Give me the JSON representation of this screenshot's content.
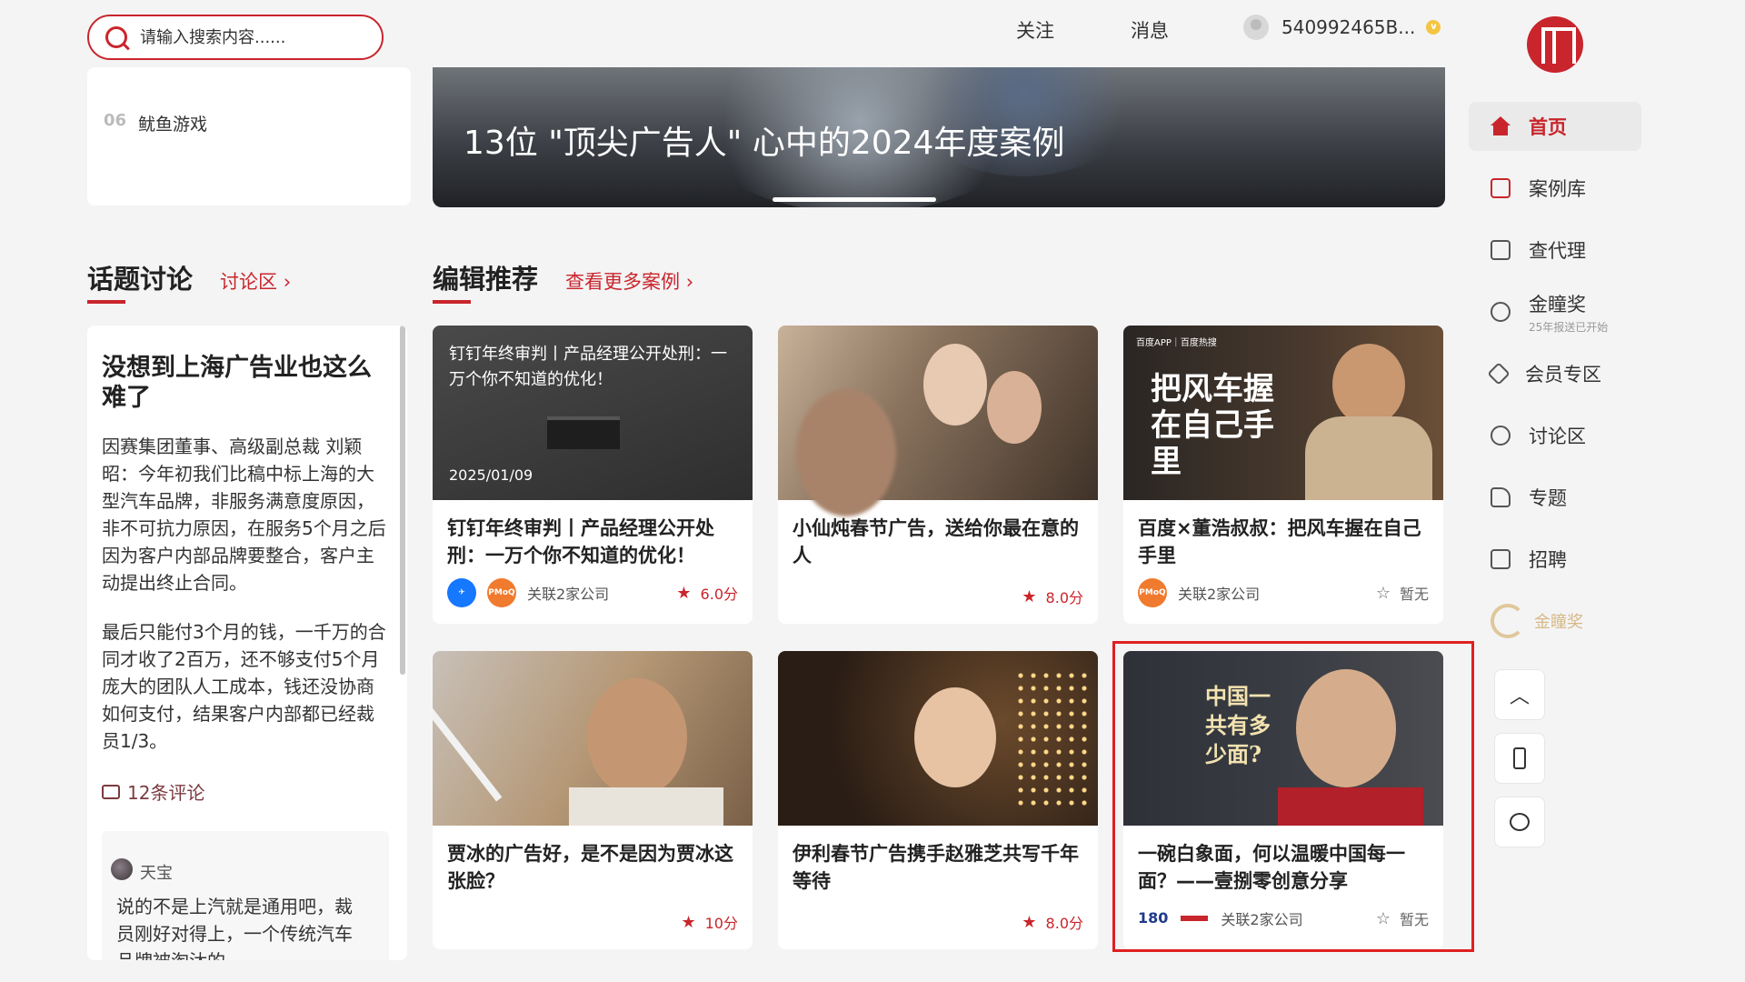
{
  "search": {
    "placeholder": "请输入搜索内容......"
  },
  "topnav": {
    "follow": "关注",
    "messages": "消息",
    "username": "540992465B...",
    "vip_badge": "v"
  },
  "ranking": {
    "number": "06",
    "label": "鱿鱼游戏"
  },
  "banner": {
    "title": "13位 \"顶尖广告人\" 心中的2024年度案例"
  },
  "discussion_section": {
    "title": "话题讨论",
    "link": "讨论区 ›"
  },
  "editor_section": {
    "title": "编辑推荐",
    "link": "查看更多案例 ›"
  },
  "discussion": {
    "title": "没想到上海广告业也这么难了",
    "para1": "因赛集团董事、高级副总裁 刘颖昭：今年初我们比稿中标上海的大型汽车品牌，非服务满意度原因，非不可抗力原因，在服务5个月之后因为客户内部品牌要整合，客户主动提出终止合同。",
    "para2": "最后只能付3个月的钱，一千万的合同才收了2百万，还不够支付5个月庞大的团队人工成本，钱还没协商如何支付，结果客户内部都已经裁员1/3。",
    "comments": "12条评论",
    "reply_user": "天宝",
    "reply_text": "说的不是上汽就是通用吧，裁员刚好对得上，一个传统汽车品牌被淘汰的"
  },
  "cards": [
    {
      "title": "钉钉年终审判丨产品经理公开处刑：一万个你不知道的优化！",
      "overlay": "钉钉年终审判丨产品经理公开处刑：一万个你不知道的优化！",
      "date": "2025/01/09",
      "company": "关联2家公司",
      "score": "6.0分",
      "logo1": "",
      "logo2": "PMoQ"
    },
    {
      "title": "小仙炖春节广告，送给你最在意的人",
      "company": "",
      "score": "8.0分"
    },
    {
      "title": "百度×董浩叔叔：把风车握在自己手里",
      "company": "关联2家公司",
      "score": "暂无",
      "logo2": "PMoQ",
      "img_text": "把风车握在自己手里",
      "img_tag": "百度APP｜百度热搜"
    },
    {
      "title": "贾冰的广告好，是不是因为贾冰这张脸？",
      "company": "",
      "score": "10分"
    },
    {
      "title": "伊利春节广告携手赵雅芝共写千年等待",
      "company": "",
      "score": "8.0分"
    },
    {
      "title": "一碗白象面，何以温暖中国每一面？——壹捌零创意分享",
      "company": "关联2家公司",
      "score": "暂无",
      "img_text": "中国一共有多少面?",
      "logo1": "180"
    }
  ],
  "sidebar": {
    "items": [
      {
        "label": "首页"
      },
      {
        "label": "案例库"
      },
      {
        "label": "查代理"
      },
      {
        "label": "金瞳奖",
        "sub": "25年报送已开始"
      },
      {
        "label": "会员专区"
      },
      {
        "label": "讨论区"
      },
      {
        "label": "专题"
      },
      {
        "label": "招聘"
      }
    ],
    "gold_logo": "金瞳奖"
  },
  "colors": {
    "brand": "#c9252c",
    "highlight": "#e02020"
  },
  "icons": [
    "search-icon",
    "home-icon",
    "library-icon",
    "agency-icon",
    "award-icon",
    "member-icon",
    "discussion-icon",
    "topic-icon",
    "jobs-icon",
    "up-arrow-icon",
    "phone-icon",
    "chat-icon"
  ]
}
